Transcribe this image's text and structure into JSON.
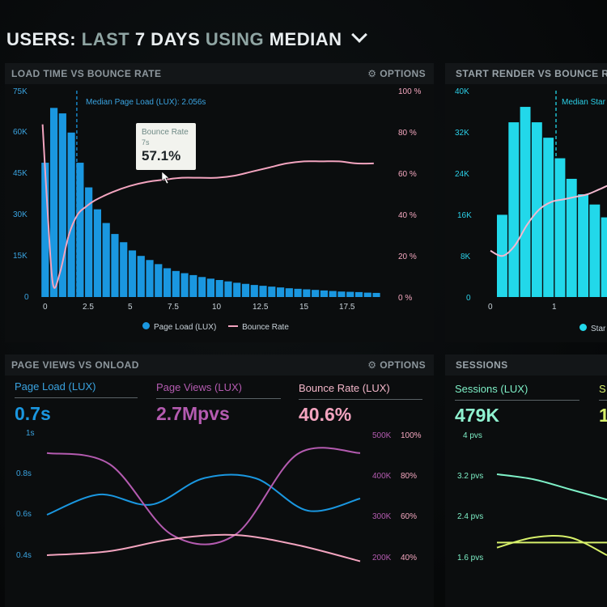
{
  "header": {
    "users": "USERS:",
    "last": "LAST",
    "days": "7 DAYS",
    "using": "USING",
    "median": "MEDIAN"
  },
  "panel1": {
    "title": "LOAD TIME VS BOUNCE RATE",
    "options": "OPTIONS",
    "median_label": "Median Page Load (LUX): 2.056s",
    "tooltip": {
      "title": "Bounce Rate",
      "sub": "7s",
      "value": "57.1%"
    },
    "y_left": [
      "75K",
      "60K",
      "45K",
      "30K",
      "15K",
      "0"
    ],
    "y_right": [
      "100 %",
      "80 %",
      "60 %",
      "40 %",
      "20 %",
      "0 %"
    ],
    "x_ticks": [
      "0",
      "2.5",
      "5",
      "7.5",
      "10",
      "12.5",
      "15",
      "17.5"
    ],
    "legend": [
      "Page Load (LUX)",
      "Bounce Rate"
    ]
  },
  "panel2": {
    "title": "START RENDER VS BOUNCE R",
    "median_label": "Median Star",
    "y_left": [
      "40K",
      "32K",
      "24K",
      "16K",
      "8K",
      "0"
    ],
    "x_ticks": [
      "0",
      "1"
    ],
    "legend": "Star"
  },
  "panel3": {
    "title": "PAGE VIEWS VS ONLOAD",
    "options": "OPTIONS",
    "kpis": [
      {
        "label": "Page Load (LUX)",
        "value": "0.7s"
      },
      {
        "label": "Page Views (LUX)",
        "value": "2.7Mpvs"
      },
      {
        "label": "Bounce Rate (LUX)",
        "value": "40.6%"
      }
    ],
    "y_left": [
      "1s",
      "0.8s",
      "0.6s",
      "0.4s"
    ],
    "y_mid": [
      "500K",
      "400K",
      "300K",
      "200K"
    ],
    "y_right": [
      "100%",
      "80%",
      "60%",
      "40%"
    ]
  },
  "panel4": {
    "title": "SESSIONS",
    "kpi_label": "Sessions (LUX)",
    "kpi_value": "479K",
    "kpi2_label": "S",
    "kpi2_value": "1",
    "y": [
      "4 pvs",
      "3.2 pvs",
      "2.4 pvs",
      "1.6 pvs"
    ]
  },
  "colors": {
    "blue": "#1a97e0",
    "pink": "#f3a4bf",
    "purple": "#b45bb0",
    "cyan": "#22d8ea",
    "green": "#7ef0c7",
    "lime": "#d7f06a"
  },
  "chart_data": [
    {
      "type": "bar",
      "title": "LOAD TIME VS BOUNCE RATE",
      "x_unit": "s",
      "xlim": [
        0,
        19.5
      ],
      "categories": [
        0,
        0.5,
        1,
        1.5,
        2,
        2.5,
        3,
        3.5,
        4,
        4.5,
        5,
        5.5,
        6,
        6.5,
        7,
        7.5,
        8,
        8.5,
        9,
        9.5,
        10,
        10.5,
        11,
        11.5,
        12,
        12.5,
        13,
        13.5,
        14,
        14.5,
        15,
        15.5,
        16,
        16.5,
        17,
        17.5,
        18,
        18.5,
        19
      ],
      "series": [
        {
          "name": "Page Load (LUX)",
          "axis": "left",
          "ylim": [
            0,
            75000
          ],
          "values": [
            49000,
            69000,
            67000,
            60000,
            49000,
            40000,
            32000,
            27000,
            23000,
            20000,
            17000,
            15000,
            13500,
            12000,
            10500,
            9500,
            8700,
            8000,
            7300,
            6700,
            6200,
            5700,
            5200,
            4800,
            4400,
            4100,
            3800,
            3500,
            3200,
            3000,
            2800,
            2600,
            2400,
            2200,
            2000,
            1900,
            1800,
            1600,
            1500
          ]
        },
        {
          "name": "Bounce Rate",
          "axis": "right",
          "ylim": [
            0,
            100
          ],
          "type": "line",
          "x": [
            0,
            0.3,
            0.6,
            1,
            1.5,
            2,
            2.5,
            3,
            4,
            5,
            6,
            7,
            8,
            9,
            10,
            11,
            12,
            13,
            14,
            15,
            16,
            17,
            18,
            19
          ],
          "values": [
            84,
            40,
            6,
            12,
            30,
            40,
            44,
            47,
            51,
            54,
            56,
            57.1,
            58,
            58,
            58,
            59,
            61,
            63,
            65,
            66,
            66,
            66,
            65,
            65
          ]
        }
      ]
    },
    {
      "type": "bar",
      "title": "START RENDER VS BOUNCE R",
      "ylim": [
        0,
        40000
      ],
      "values": [
        16000,
        34000,
        37000,
        34000,
        31000,
        27000,
        23000,
        20000,
        18000,
        15500,
        13000,
        11000
      ],
      "line": [
        9000,
        8000,
        10000,
        14000,
        17000,
        18500,
        19000,
        19500,
        20000,
        21000,
        22000,
        22500
      ]
    },
    {
      "type": "line",
      "title": "PAGE VIEWS VS ONLOAD",
      "series": [
        {
          "name": "Page Load (LUX)",
          "values": [
            0.6,
            0.7,
            0.65,
            0.78,
            0.78,
            0.62,
            0.68
          ]
        },
        {
          "name": "Page Views (LUX)",
          "values": [
            0.905,
            0.85,
            0.5,
            0.5,
            0.9,
            0.905
          ]
        },
        {
          "name": "Bounce Rate (LUX)",
          "values": [
            0.4,
            0.42,
            0.48,
            0.5,
            0.45,
            0.37
          ]
        }
      ]
    },
    {
      "type": "line",
      "title": "SESSIONS",
      "series": [
        {
          "values": [
            3.2,
            3.1,
            2.9,
            2.7
          ]
        },
        {
          "values": [
            1.85,
            1.85,
            1.85,
            1.85
          ]
        },
        {
          "values": [
            1.75,
            1.95,
            1.95,
            1.6
          ]
        }
      ]
    }
  ]
}
